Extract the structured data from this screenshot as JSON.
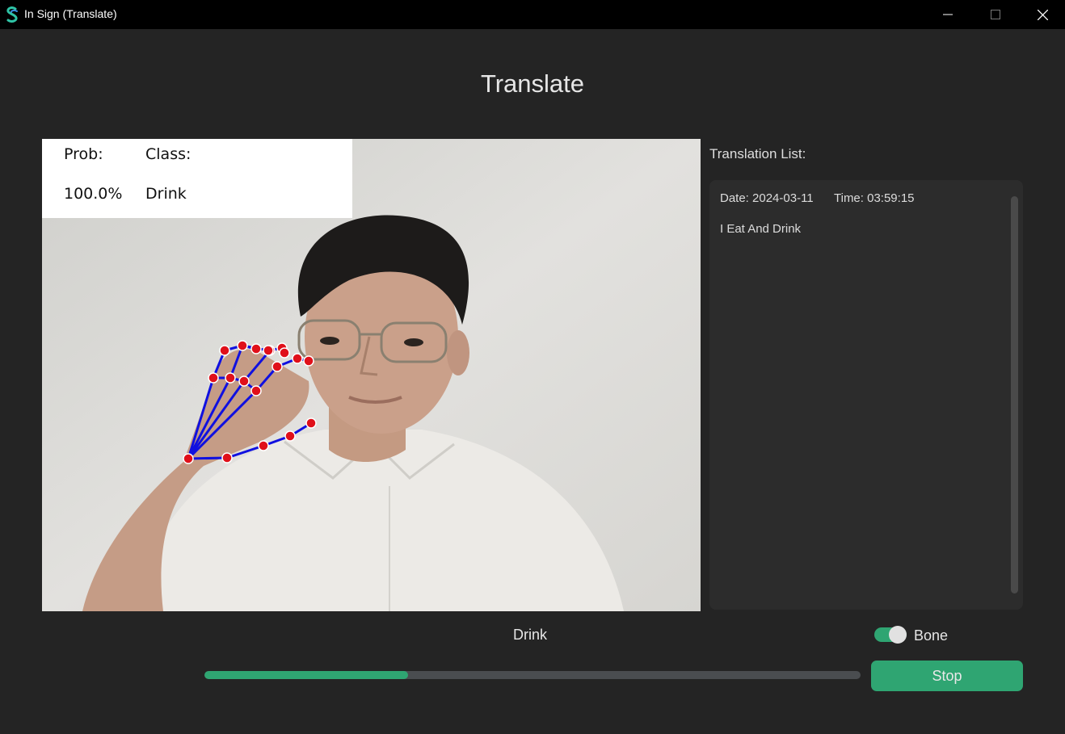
{
  "window": {
    "title": "In Sign (Translate)",
    "icon": "insign-logo-icon",
    "controls": [
      "minimize-icon",
      "maximize-icon",
      "close-icon"
    ]
  },
  "page": {
    "title": "Translate"
  },
  "camera": {
    "overlay": {
      "prob_label": "Prob:",
      "class_label": "Class:",
      "prob_value": "100.0%",
      "class_value": "Drink"
    },
    "landmark_color": "#e0101a",
    "bone_color": "#1010e0"
  },
  "translation_list": {
    "label": "Translation List:",
    "entries": [
      {
        "date": "Date: 2024-03-11",
        "time": "Time: 03:59:15",
        "text": "I Eat And Drink"
      }
    ]
  },
  "result_word": "Drink",
  "bone_toggle": {
    "label": "Bone",
    "on": true
  },
  "progress": {
    "value": 0.31
  },
  "stop_button": {
    "label": "Stop"
  },
  "colors": {
    "accent": "#2fa572",
    "background": "#242424",
    "panel": "#2c2c2c"
  }
}
